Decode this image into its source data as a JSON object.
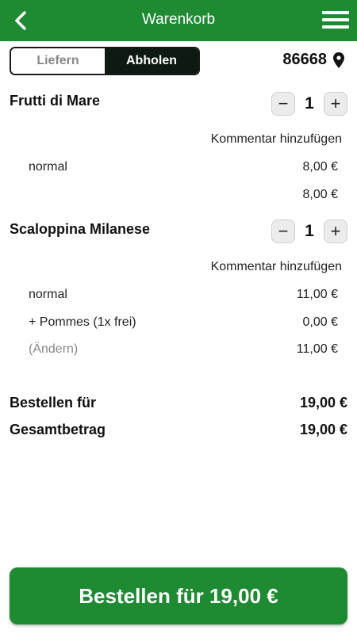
{
  "header": {
    "title": "Warenkorb"
  },
  "delivery_toggle": {
    "option_delivery": "Liefern",
    "option_pickup": "Abholen",
    "selected": "Abholen"
  },
  "location": {
    "zip": "86668"
  },
  "cart": {
    "items": [
      {
        "name": "Frutti di Mare",
        "quantity": "1",
        "comment_link": "Kommentar hinzufügen",
        "size_label": "normal",
        "size_price": "8,00 €",
        "item_total": "8,00 €"
      },
      {
        "name": "Scaloppina Milanese",
        "quantity": "1",
        "comment_link": "Kommentar hinzufügen",
        "size_label": "normal",
        "size_price": "11,00 €",
        "extra_label": "+ Pommes (1x frei)",
        "extra_price": "0,00 €",
        "change_label": "(Ändern)",
        "item_total": "11,00 €"
      }
    ]
  },
  "summary": {
    "order_for_label": "Bestellen für",
    "order_for_value": "19,00 €",
    "total_label": "Gesamtbetrag",
    "total_value": "19,00 €"
  },
  "footer": {
    "order_button_label": "Bestellen für 19,00 €"
  },
  "colors": {
    "brand_green": "#1e8a32",
    "toggle_active": "#0d1a12"
  },
  "icons": {
    "back": "chevron-left-icon",
    "menu": "hamburger-menu-icon",
    "location": "map-pin-icon",
    "decrement": "minus-icon",
    "increment": "plus-icon"
  }
}
